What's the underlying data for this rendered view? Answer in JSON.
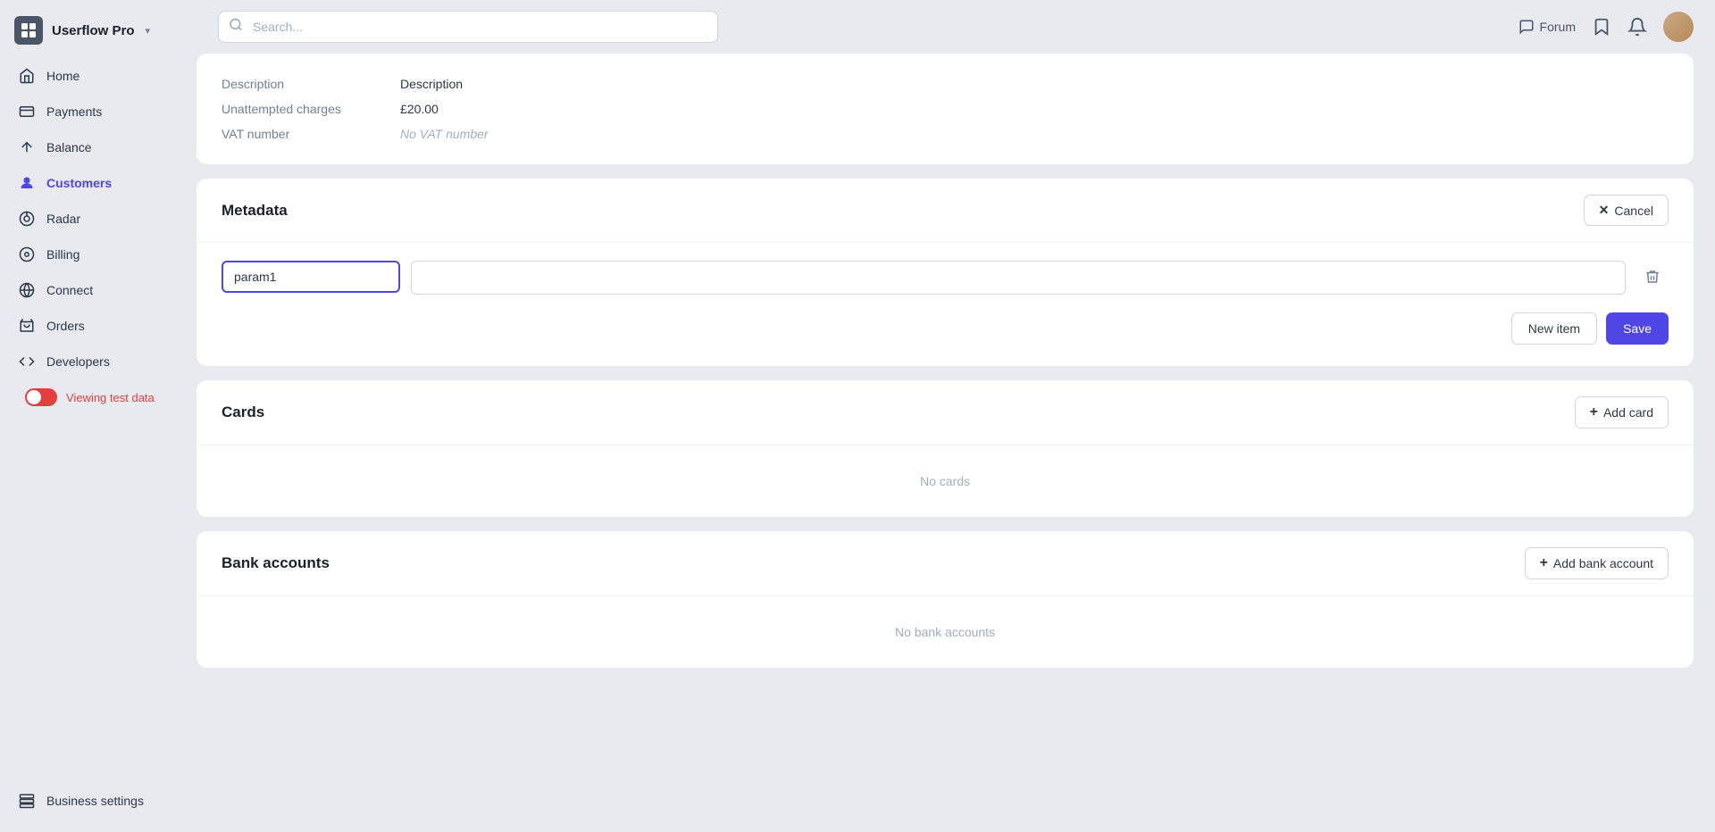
{
  "app": {
    "name": "Userflow Pro",
    "chevron": "▾"
  },
  "search": {
    "placeholder": "Search..."
  },
  "topbar": {
    "forum_label": "Forum"
  },
  "sidebar": {
    "items": [
      {
        "id": "home",
        "label": "Home",
        "active": false
      },
      {
        "id": "payments",
        "label": "Payments",
        "active": false
      },
      {
        "id": "balance",
        "label": "Balance",
        "active": false
      },
      {
        "id": "customers",
        "label": "Customers",
        "active": true
      },
      {
        "id": "radar",
        "label": "Radar",
        "active": false
      },
      {
        "id": "billing",
        "label": "Billing",
        "active": false
      },
      {
        "id": "connect",
        "label": "Connect",
        "active": false
      },
      {
        "id": "orders",
        "label": "Orders",
        "active": false
      },
      {
        "id": "developers",
        "label": "Developers",
        "active": false
      }
    ],
    "toggle_label": "Viewing test data",
    "bottom_item": {
      "id": "business-settings",
      "label": "Business settings"
    }
  },
  "customer_info": {
    "rows": [
      {
        "label": "Description",
        "value": "Description",
        "placeholder": false
      },
      {
        "label": "Unattempted charges",
        "value": "£20.00",
        "placeholder": false
      },
      {
        "label": "VAT number",
        "value": "No VAT number",
        "placeholder": true
      }
    ]
  },
  "metadata": {
    "title": "Metadata",
    "cancel_label": "Cancel",
    "param_key": "param1",
    "param_value": "",
    "new_item_label": "New item",
    "save_label": "Save"
  },
  "cards": {
    "title": "Cards",
    "add_label": "Add card",
    "empty": "No cards"
  },
  "bank_accounts": {
    "title": "Bank accounts",
    "add_label": "Add bank account",
    "empty": "No bank accounts"
  }
}
